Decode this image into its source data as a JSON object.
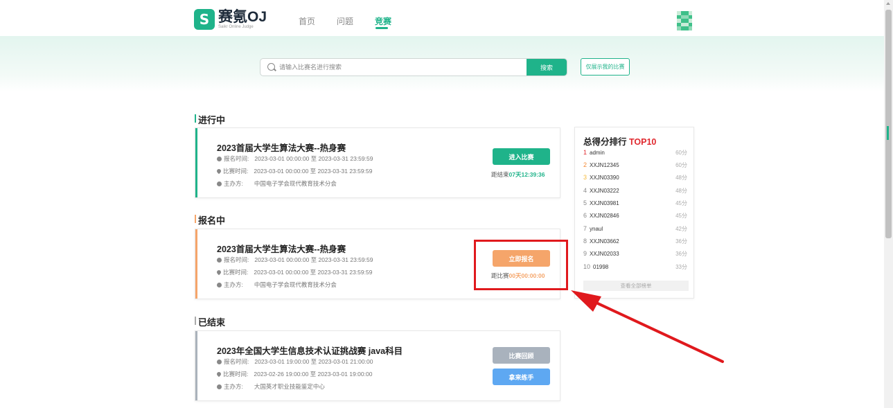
{
  "header": {
    "logo_mark": "S",
    "logo_title": "赛氪OJ",
    "logo_subtitle": "Saikr Online Judge",
    "nav": [
      {
        "label": "首页",
        "active": false
      },
      {
        "label": "问题",
        "active": false
      },
      {
        "label": "竞赛",
        "active": true
      }
    ]
  },
  "search": {
    "placeholder": "请输入比赛名进行搜索",
    "button_label": "搜索",
    "mine_label": "仅展示我的比赛"
  },
  "sections": {
    "ongoing": {
      "title": "进行中",
      "contest": {
        "title": "2023首届大学生算法大赛--热身赛",
        "reg_label": "报名时间:",
        "reg_time": "2023-03-01 00:00:00 至 2023-03-31 23:59:59",
        "match_label": "比赛时间:",
        "match_time": "2023-03-01 00:00:00 至 2023-03-31 23:59:59",
        "host_label": "主办方:",
        "host": "中国电子学会现代教育技术分会",
        "button": "进入比赛",
        "countdown_prefix": "距结束",
        "countdown_days": "07天",
        "countdown_time": "12:39:36"
      }
    },
    "registering": {
      "title": "报名中",
      "contest": {
        "title": "2023首届大学生算法大赛--热身赛",
        "reg_label": "报名时间:",
        "reg_time": "2023-03-01 00:00:00 至 2023-03-31 23:59:59",
        "match_label": "比赛时间:",
        "match_time": "2023-03-01 00:00:00 至 2023-03-31 23:59:59",
        "host_label": "主办方:",
        "host": "中国电子学会现代教育技术分会",
        "button": "立即报名",
        "countdown_prefix": "距比赛",
        "countdown_days": "00天",
        "countdown_time": "00:00:00"
      }
    },
    "ended": {
      "title": "已结束",
      "contest": {
        "title": "2023年全国大学生信息技术认证挑战赛 java科目",
        "reg_label": "报名时间:",
        "reg_time": "2023-03-01 19:00:00 至 2023-03-01 21:00:00",
        "match_label": "比赛时间:",
        "match_time": "2023-02-26 19:00:00 至 2023-03-01 19:00:00",
        "host_label": "主办方:",
        "host": "大国英才职业技能鉴定中心",
        "button_review": "比赛回顾",
        "button_practice": "拿来练手"
      }
    }
  },
  "ranking": {
    "title_prefix": "总得分排行 ",
    "title_highlight": "TOP10",
    "rows": [
      {
        "rank": "1",
        "name": "admin",
        "score": "60分"
      },
      {
        "rank": "2",
        "name": "XXJN12345",
        "score": "60分"
      },
      {
        "rank": "3",
        "name": "XXJN03390",
        "score": "48分"
      },
      {
        "rank": "4",
        "name": "XXJN03222",
        "score": "48分"
      },
      {
        "rank": "5",
        "name": "XXJN03981",
        "score": "45分"
      },
      {
        "rank": "6",
        "name": "XXJN02846",
        "score": "45分"
      },
      {
        "rank": "7",
        "name": "ynaul",
        "score": "42分"
      },
      {
        "rank": "8",
        "name": "XXJN03662",
        "score": "36分"
      },
      {
        "rank": "9",
        "name": "XXJN02033",
        "score": "36分"
      },
      {
        "rank": "10",
        "name": "01998",
        "score": "33分"
      }
    ],
    "view_all": "查看全部榜单"
  },
  "colors": {
    "brand": "#1fb38a",
    "orange": "#f5a56a",
    "gray_button": "#a9b2bd",
    "blue_button": "#5ea8f2",
    "annotation_red": "#e0191d"
  }
}
